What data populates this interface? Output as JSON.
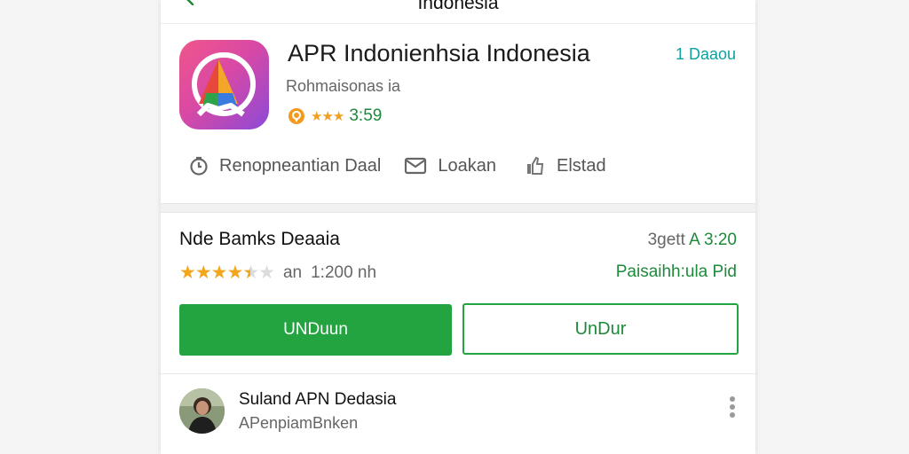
{
  "topbar": {
    "title": "Indonesia",
    "back_icon": "chevron-left-icon"
  },
  "app": {
    "title": "APR Indonienhsia Indonesia",
    "side_link": "1 Daaou",
    "subtitle": "Rohmaisonas ia",
    "rating_badge_icon": "badge-icon",
    "rating_value": "3:59",
    "mini_stars": "★★★"
  },
  "actions": [
    {
      "icon": "clock-icon",
      "label": "Renopneantian Daal"
    },
    {
      "icon": "mail-icon",
      "label": "Loakan"
    },
    {
      "icon": "thumbs-up-icon",
      "label": "Elstad"
    }
  ],
  "download": {
    "title": "Nde Bamks Deaaia",
    "right_top_label": "3gett",
    "right_top_value": "A 3:20",
    "stars_filled": "★★★★",
    "stars_half": "★",
    "stars_empty": "★",
    "rating_text": "an",
    "count": "1:200 nh",
    "right_link": "Paisaihh:ula Pid",
    "primary_button": "UNDuun",
    "secondary_button": "UnDur"
  },
  "publisher": {
    "name": "Suland APN Dedasia",
    "subtitle": "APenpiamBnken",
    "more_icon": "more-vertical-icon"
  },
  "colors": {
    "accent_green": "#23a441",
    "teal_link": "#10a0a0",
    "star": "#f2a61e"
  }
}
